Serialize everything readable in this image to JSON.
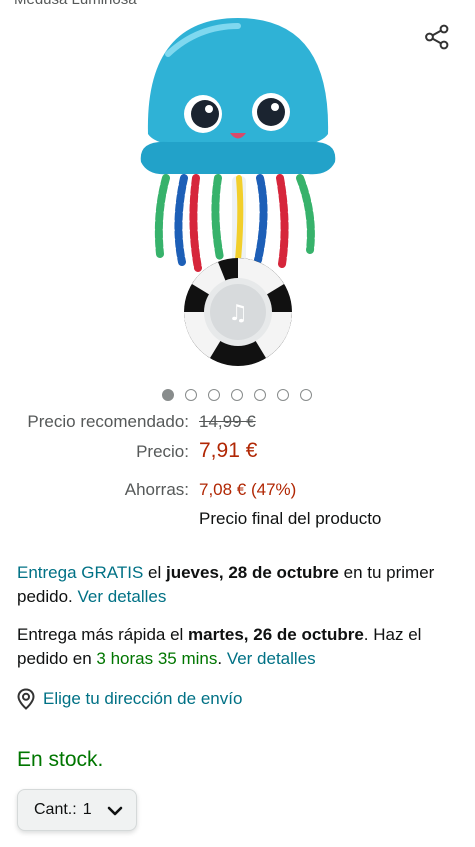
{
  "page_title": "Medusa Luminosa",
  "icons": {
    "share": "share-icon",
    "location": "location-pin-icon",
    "quantity_dropdown": "chevron-down-icon"
  },
  "gallery": {
    "total_images": 7,
    "active_index": 0
  },
  "price": {
    "recommended_label": "Precio recomendado:",
    "recommended_value": "14,99 €",
    "price_label": "Precio:",
    "price_value": "7,91 €",
    "savings_label": "Ahorras:",
    "savings_value": "7,08 € (47%)",
    "final_note": "Precio final del producto"
  },
  "delivery1": {
    "link_text": "Entrega GRATIS",
    "text_el": " el ",
    "date": "jueves, 28 de octubre",
    "text_after": " en tu primer pedido. ",
    "details_link": "Ver detalles"
  },
  "delivery2": {
    "prefix": "Entrega más rápida el ",
    "date": "martes, 26 de octubre",
    "middle": ". Haz el pedido en ",
    "countdown": "3 horas 35 mins",
    "dot": ". ",
    "details_link": "Ver detalles"
  },
  "address": {
    "label": "Elige tu dirección de envío"
  },
  "stock": {
    "label": "En stock."
  },
  "quantity": {
    "label": "Cant.:",
    "value": "1"
  },
  "colors": {
    "link": "#007185",
    "price_red": "#b12704",
    "in_stock_green": "#007600"
  }
}
